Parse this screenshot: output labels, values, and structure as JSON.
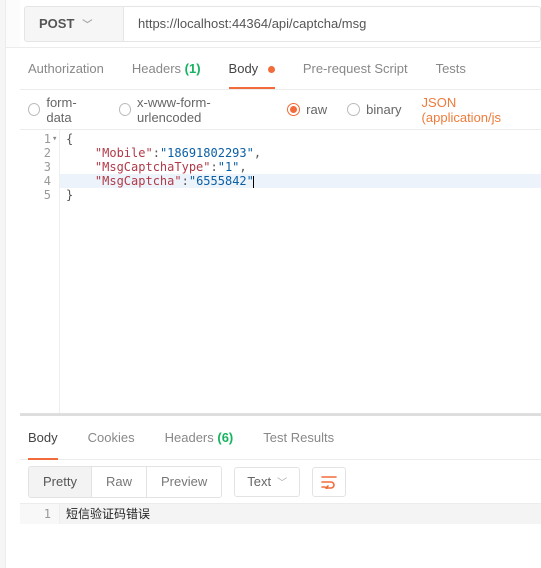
{
  "request": {
    "method": "POST",
    "url": "https://localhost:44364/api/captcha/msg"
  },
  "reqTabs": {
    "authorization": "Authorization",
    "headers": "Headers",
    "headersCount": "(1)",
    "body": "Body",
    "prerequest": "Pre-request Script",
    "tests": "Tests"
  },
  "bodyOpts": {
    "formdata": "form-data",
    "urlencoded": "x-www-form-urlencoded",
    "raw": "raw",
    "binary": "binary",
    "contentType": "JSON (application/js"
  },
  "editor": {
    "lines": [
      "1",
      "2",
      "3",
      "4",
      "5"
    ],
    "foldMark": "▾",
    "l1": "{",
    "l2_key": "\"Mobile\"",
    "l2_val": "\"18691802293\"",
    "l3_key": "\"MsgCaptchaType\"",
    "l3_val": "\"1\"",
    "l4_key": "\"MsgCaptcha\"",
    "l4_val": "\"6555842\"",
    "l5": "}",
    "colon": ":",
    "comma": ","
  },
  "resTabs": {
    "body": "Body",
    "cookies": "Cookies",
    "headers": "Headers",
    "headersCount": "(6)",
    "tests": "Test Results"
  },
  "resToolbar": {
    "pretty": "Pretty",
    "raw": "Raw",
    "preview": "Preview",
    "mode": "Text"
  },
  "response": {
    "line1no": "1",
    "line1": "短信验证码错误"
  }
}
